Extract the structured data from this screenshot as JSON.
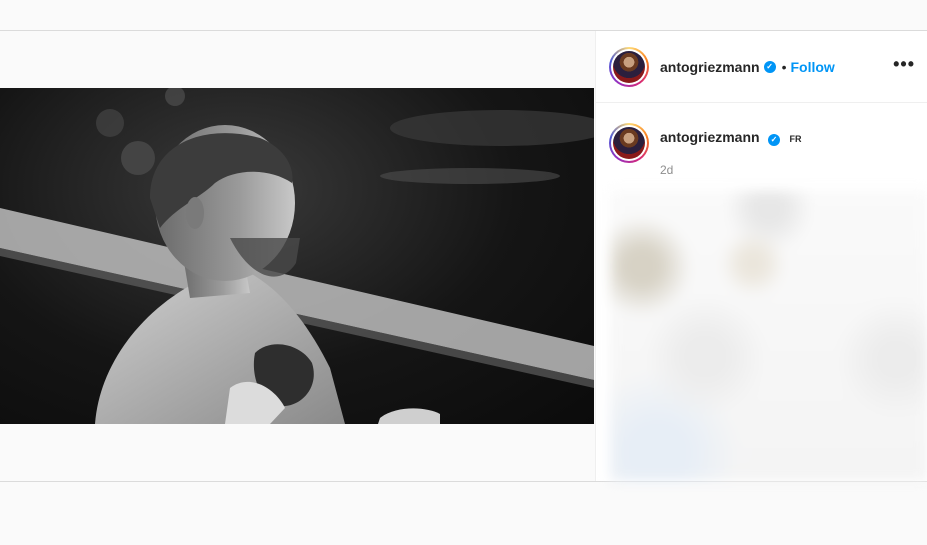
{
  "post": {
    "username": "antogriezmann",
    "verified_mark": "✓",
    "separator": "•",
    "follow_label": "Follow",
    "more_label": "•••",
    "caption_username": "antogriezmann",
    "caption_country": "FR",
    "timestamp": "2d"
  },
  "icons": {
    "verified": "verified-badge-icon",
    "more": "more-options-icon"
  },
  "colors": {
    "accent": "#0095f6",
    "text": "#262626",
    "muted": "#8e8e8e",
    "border": "#dbdbdb"
  }
}
